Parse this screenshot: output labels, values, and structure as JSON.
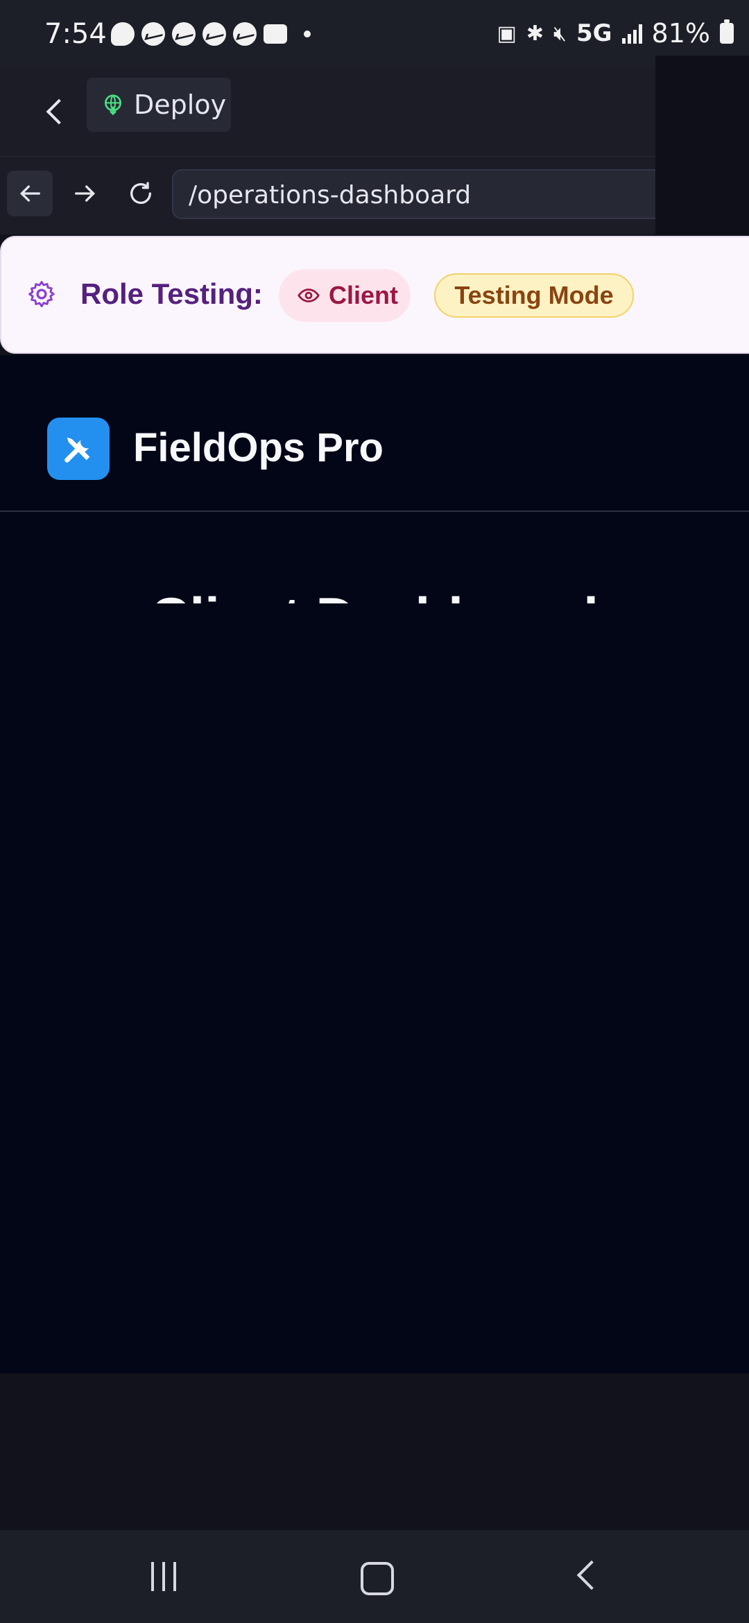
{
  "status_bar": {
    "time": "7:54",
    "network": "5G",
    "battery": "81%",
    "notification_icons": [
      "threads-icon",
      "messenger-icon",
      "messenger-icon",
      "messenger-icon",
      "messenger-icon",
      "wallet-icon"
    ]
  },
  "browser": {
    "deploy_label": "Deploy",
    "url": "/operations-dashboard"
  },
  "role_banner": {
    "label": "Role Testing:",
    "role": "Client",
    "mode": "Testing Mode"
  },
  "app": {
    "brand_name": "FieldOps Pro",
    "page_title": "Client Dashboard",
    "brand_color": "#2390f0"
  }
}
